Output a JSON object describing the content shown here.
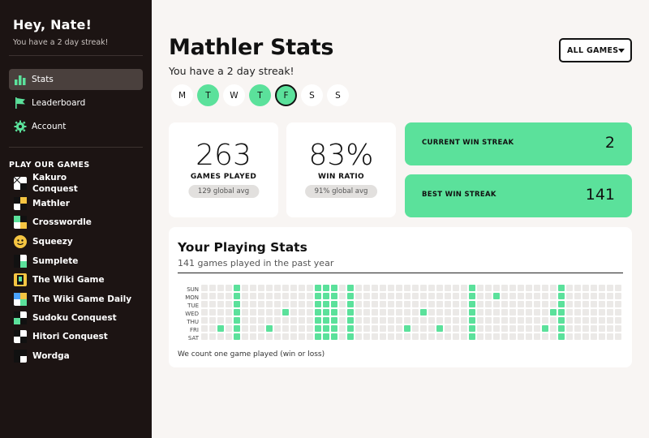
{
  "sidebar": {
    "greeting": "Hey, Nate!",
    "greeting_sub": "You have a 2 day streak!",
    "nav": [
      {
        "label": "Stats",
        "icon": "bar-chart-icon",
        "active": true
      },
      {
        "label": "Leaderboard",
        "icon": "flag-icon",
        "active": false
      },
      {
        "label": "Account",
        "icon": "gear-icon",
        "active": false
      }
    ],
    "section_title": "PLAY OUR GAMES",
    "games": [
      {
        "label": "Kakuro Conquest",
        "icon": "kakuro-icon"
      },
      {
        "label": "Mathler",
        "icon": "mathler-icon"
      },
      {
        "label": "Crosswordle",
        "icon": "crosswordle-icon"
      },
      {
        "label": "Squeezy",
        "icon": "squeezy-icon"
      },
      {
        "label": "Sumplete",
        "icon": "sumplete-icon"
      },
      {
        "label": "The Wiki Game",
        "icon": "wiki-game-icon"
      },
      {
        "label": "The Wiki Game Daily",
        "icon": "wiki-game-daily-icon"
      },
      {
        "label": "Sudoku Conquest",
        "icon": "sudoku-icon"
      },
      {
        "label": "Hitori Conquest",
        "icon": "hitori-icon"
      },
      {
        "label": "Wordga",
        "icon": "wordga-icon"
      }
    ]
  },
  "main": {
    "title": "Mathler Stats",
    "subtitle": "You have a 2 day streak!",
    "days": [
      {
        "label": "M",
        "played": false,
        "today": false
      },
      {
        "label": "T",
        "played": true,
        "today": false
      },
      {
        "label": "W",
        "played": false,
        "today": false
      },
      {
        "label": "T",
        "played": true,
        "today": false
      },
      {
        "label": "F",
        "played": true,
        "today": true
      },
      {
        "label": "S",
        "played": false,
        "today": false
      },
      {
        "label": "S",
        "played": false,
        "today": false
      }
    ],
    "filter": {
      "label": "ALL GAMES"
    },
    "games_played": {
      "value": "263",
      "label": "GAMES PLAYED",
      "avg": "129 global avg"
    },
    "win_ratio": {
      "value": "83%",
      "label": "WIN RATIO",
      "avg": "91% global avg"
    },
    "current_streak": {
      "label": "CURRENT WIN STREAK",
      "value": "2"
    },
    "best_streak": {
      "label": "BEST WIN STREAK",
      "value": "141"
    },
    "playing": {
      "title": "Your Playing Stats",
      "subtitle": "141 games played in the past year",
      "day_labels": [
        "SUN",
        "MON",
        "TUE",
        "WED",
        "THU",
        "FRI",
        "SAT"
      ],
      "weeks": 52,
      "played_cells": [
        [
          4,
          0
        ],
        [
          4,
          1
        ],
        [
          4,
          2
        ],
        [
          4,
          3
        ],
        [
          4,
          4
        ],
        [
          4,
          5
        ],
        [
          4,
          6
        ],
        [
          2,
          5
        ],
        [
          8,
          5
        ],
        [
          10,
          3
        ],
        [
          14,
          0
        ],
        [
          14,
          1
        ],
        [
          14,
          2
        ],
        [
          14,
          3
        ],
        [
          14,
          4
        ],
        [
          14,
          5
        ],
        [
          14,
          6
        ],
        [
          15,
          0
        ],
        [
          15,
          1
        ],
        [
          15,
          2
        ],
        [
          15,
          3
        ],
        [
          15,
          4
        ],
        [
          15,
          5
        ],
        [
          15,
          6
        ],
        [
          16,
          0
        ],
        [
          16,
          1
        ],
        [
          16,
          2
        ],
        [
          16,
          3
        ],
        [
          16,
          4
        ],
        [
          16,
          5
        ],
        [
          16,
          6
        ],
        [
          18,
          0
        ],
        [
          18,
          1
        ],
        [
          18,
          2
        ],
        [
          18,
          3
        ],
        [
          18,
          4
        ],
        [
          18,
          5
        ],
        [
          18,
          6
        ],
        [
          25,
          5
        ],
        [
          27,
          3
        ],
        [
          29,
          5
        ],
        [
          33,
          0
        ],
        [
          33,
          1
        ],
        [
          33,
          2
        ],
        [
          33,
          3
        ],
        [
          33,
          4
        ],
        [
          33,
          5
        ],
        [
          33,
          6
        ],
        [
          36,
          1
        ],
        [
          42,
          5
        ],
        [
          43,
          3
        ],
        [
          44,
          0
        ],
        [
          44,
          1
        ],
        [
          44,
          2
        ],
        [
          44,
          3
        ],
        [
          44,
          4
        ],
        [
          44,
          5
        ],
        [
          44,
          6
        ]
      ],
      "footnote": "We count one game played (win or loss)"
    }
  },
  "colors": {
    "accent": "#5be19b",
    "sidebar_bg": "#1c1413",
    "page_bg": "#f8f5f3"
  }
}
